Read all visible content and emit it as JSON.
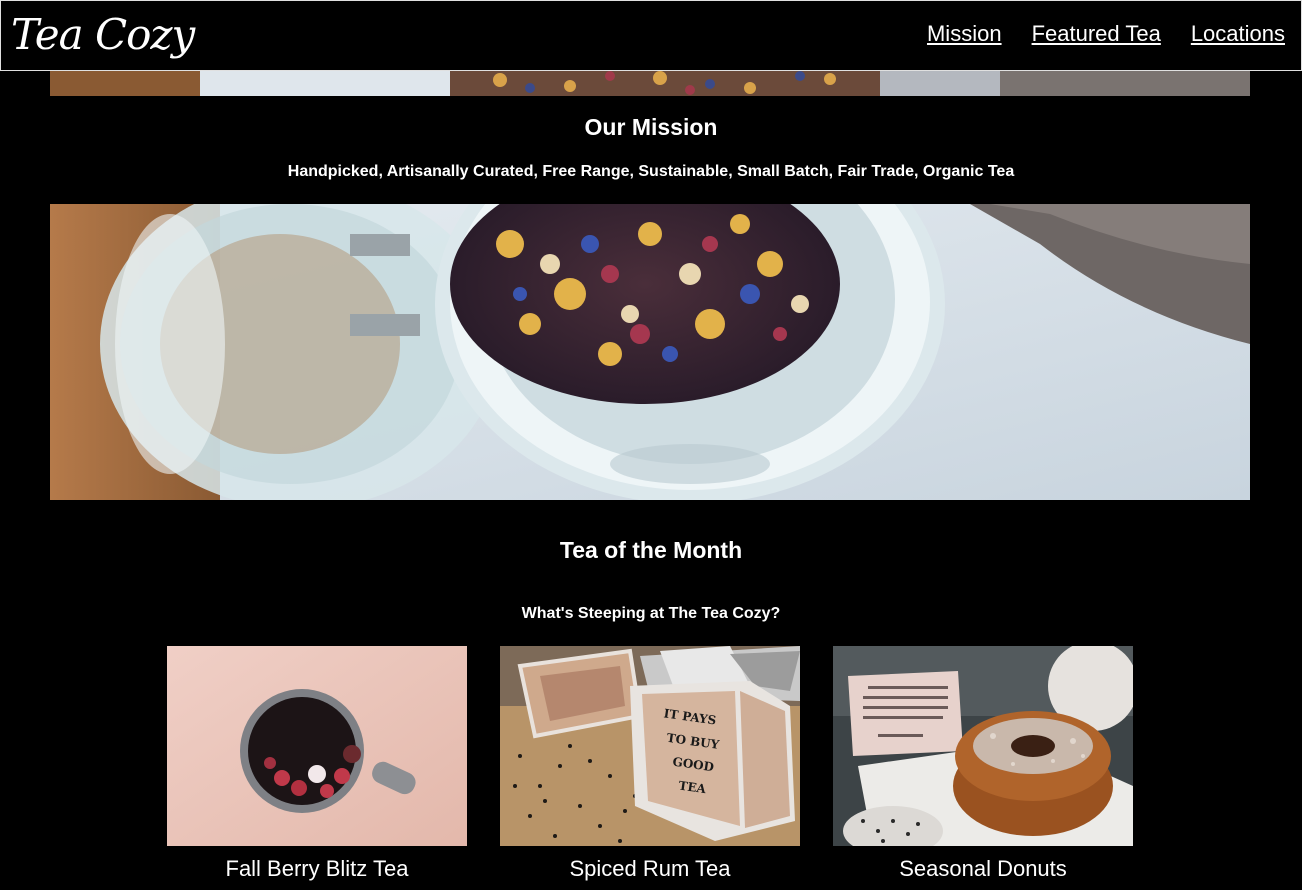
{
  "header": {
    "logo": "Tea Cozy",
    "nav": [
      "Mission",
      "Featured Tea",
      "Locations"
    ]
  },
  "mission": {
    "title": "Our Mission",
    "subtitle": "Handpicked, Artisanally Curated, Free Range, Sustainable, Small Batch, Fair Trade, Organic Tea"
  },
  "tea_of_month": {
    "title": "Tea of the Month",
    "subtitle": "What's Steeping at The Tea Cozy?",
    "items": [
      {
        "caption": "Fall Berry Blitz Tea"
      },
      {
        "caption": "Spiced Rum Tea"
      },
      {
        "caption": "Seasonal Donuts"
      }
    ]
  },
  "box_sign": [
    "IT PAYS",
    "TO BUY",
    "GOOD",
    "TEA"
  ],
  "colors": {
    "background": "#000000",
    "text": "#ffffff",
    "header_border": "#e0e0e0"
  }
}
